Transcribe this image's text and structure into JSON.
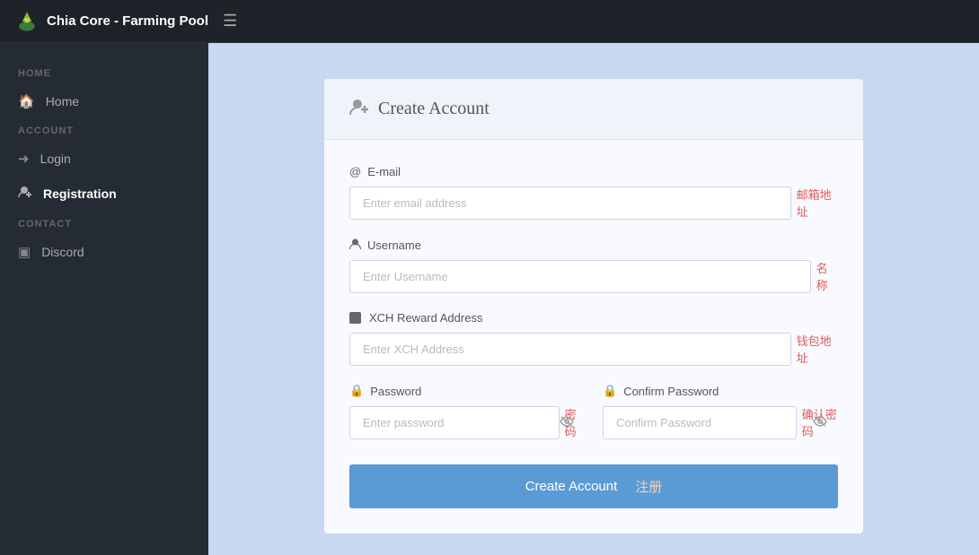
{
  "navbar": {
    "brand": "Chia Core - Farming Pool",
    "hamburger_label": "☰"
  },
  "sidebar": {
    "sections": [
      {
        "label": "HOME",
        "items": [
          {
            "id": "home",
            "icon": "🏠",
            "text": "Home",
            "active": false
          }
        ]
      },
      {
        "label": "ACCOUNT",
        "items": [
          {
            "id": "login",
            "icon": "→",
            "text": "Login",
            "active": false
          },
          {
            "id": "registration",
            "icon": "👤+",
            "text": "Registration",
            "active": true
          }
        ]
      },
      {
        "label": "CONTACT",
        "items": [
          {
            "id": "discord",
            "icon": "▣",
            "text": "Discord",
            "active": false
          }
        ]
      }
    ]
  },
  "card": {
    "header_icon": "👤+",
    "title": "Create Account",
    "form": {
      "email": {
        "label": "E-mail",
        "label_icon": "@",
        "placeholder": "Enter email address",
        "annotation": "邮箱地址"
      },
      "username": {
        "label": "Username",
        "label_icon": "👤",
        "placeholder": "Enter Username",
        "annotation": "名称"
      },
      "xch_address": {
        "label": "XCH Reward Address",
        "label_icon": "▣",
        "placeholder": "Enter XCH Address",
        "annotation": "钱包地址"
      },
      "password": {
        "label": "Password",
        "label_icon": "🔒",
        "placeholder": "Enter password",
        "annotation": "密码"
      },
      "confirm_password": {
        "label": "Confirm Password",
        "label_icon": "🔒",
        "placeholder": "Confirm Password",
        "annotation": "确认密码"
      },
      "submit_label": "Create Account",
      "submit_annotation": "注册"
    }
  }
}
